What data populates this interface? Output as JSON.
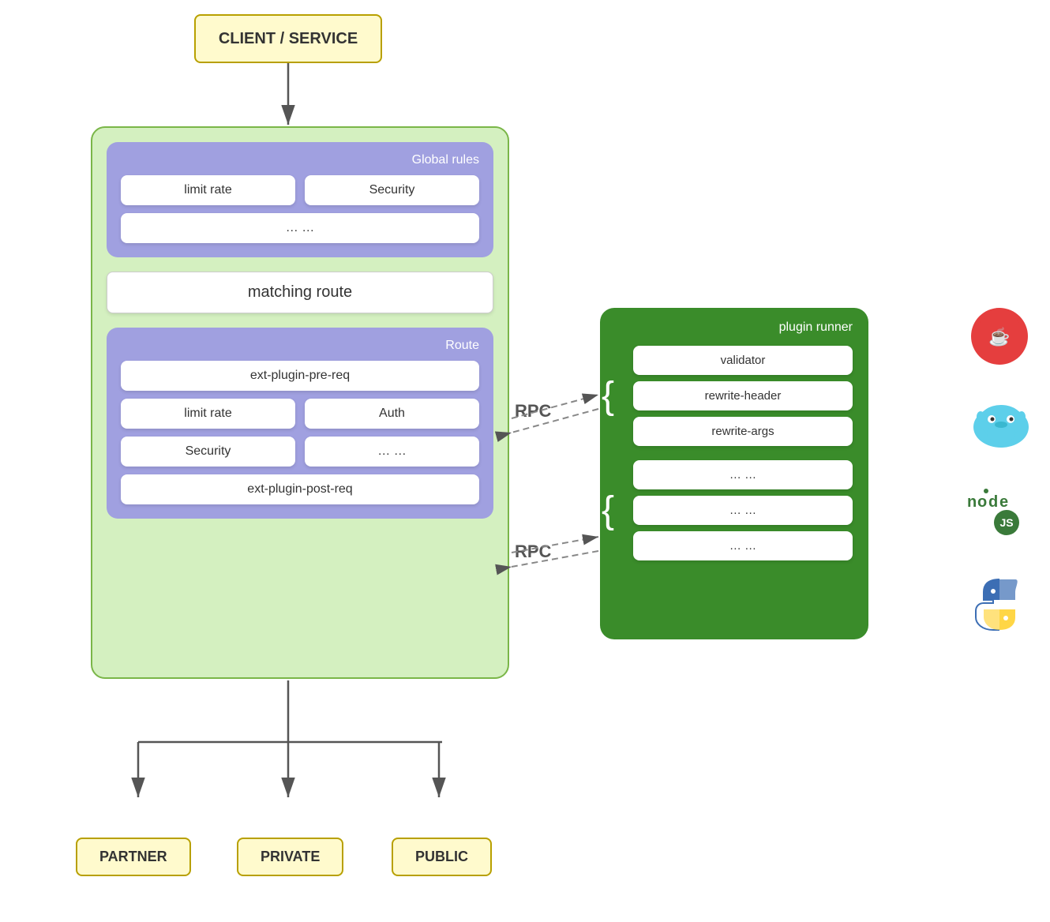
{
  "diagram": {
    "title": "CLIENT / SERVICE",
    "main_container": {
      "label": ""
    },
    "global_rules": {
      "label": "Global rules",
      "plugins": [
        "limit rate",
        "Security"
      ],
      "ellipsis": "… …"
    },
    "matching_route": "matching route",
    "route": {
      "label": "Route",
      "ext_pre": "ext-plugin-pre-req",
      "plugins": [
        [
          "limit rate",
          "Auth"
        ],
        [
          "Security",
          "… …"
        ]
      ],
      "ext_post": "ext-plugin-post-req"
    },
    "plugin_runner": {
      "label": "plugin runner",
      "group1": [
        "validator",
        "rewrite-header",
        "rewrite-args"
      ],
      "group2": [
        "… …",
        "… …",
        "… …"
      ]
    },
    "rpc_label": "RPC",
    "endpoints": [
      "PARTNER",
      "PRIVATE",
      "PUBLIC"
    ],
    "languages": {
      "java": "☕",
      "go": "Go",
      "node": "node\n.js",
      "python": "🐍"
    }
  }
}
